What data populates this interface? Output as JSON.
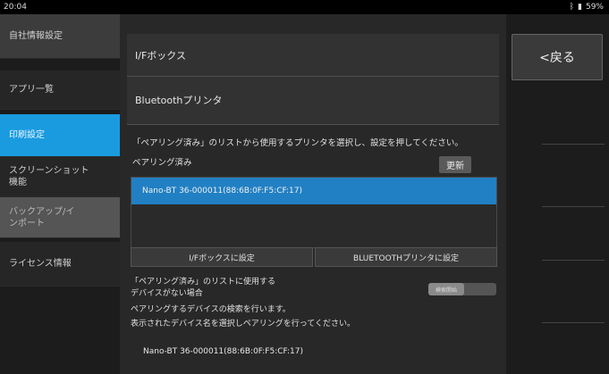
{
  "status_bar": {
    "time": "20:04",
    "battery": "59%"
  },
  "sidebar": {
    "items": [
      {
        "label": "自社情報設定"
      },
      {
        "label": "アプリ一覧"
      },
      {
        "label": "印刷設定"
      },
      {
        "label": "スクリーンショット機能"
      },
      {
        "label": "バックアップ/インポート"
      },
      {
        "label": "ライセンス情報"
      }
    ]
  },
  "main": {
    "rows": [
      {
        "label": "I/Fボックス"
      },
      {
        "label": "Bluetoothプリンタ"
      }
    ],
    "instruction": "「ペアリング済み」のリストから使用するプリンタを選択し、設定を押してください。",
    "paired_label": "ペアリング済み",
    "update_button": "更新",
    "paired_devices": [
      "Nano-BT 36-000011(88:6B:0F:F5:CF:17)"
    ],
    "set_if_box_button": "I/Fボックスに設定",
    "set_bt_printer_button": "BLUETOOTHプリンタに設定",
    "desc_lines": [
      "「ペアリング済み」のリストに使用する",
      "デバイスがない場合",
      "ペアリングするデバイスの検索を行います。",
      "表示されたデバイス名を選択しペアリングを行ってください。"
    ],
    "toggle_label": "検索開始",
    "found_device": "Nano-BT 36-000011(88:6B:0F:F5:CF:17)"
  },
  "right_panel": {
    "back_button": "<戻る"
  },
  "colors": {
    "accent": "#1a9be0",
    "selected_row": "#2180c4"
  }
}
